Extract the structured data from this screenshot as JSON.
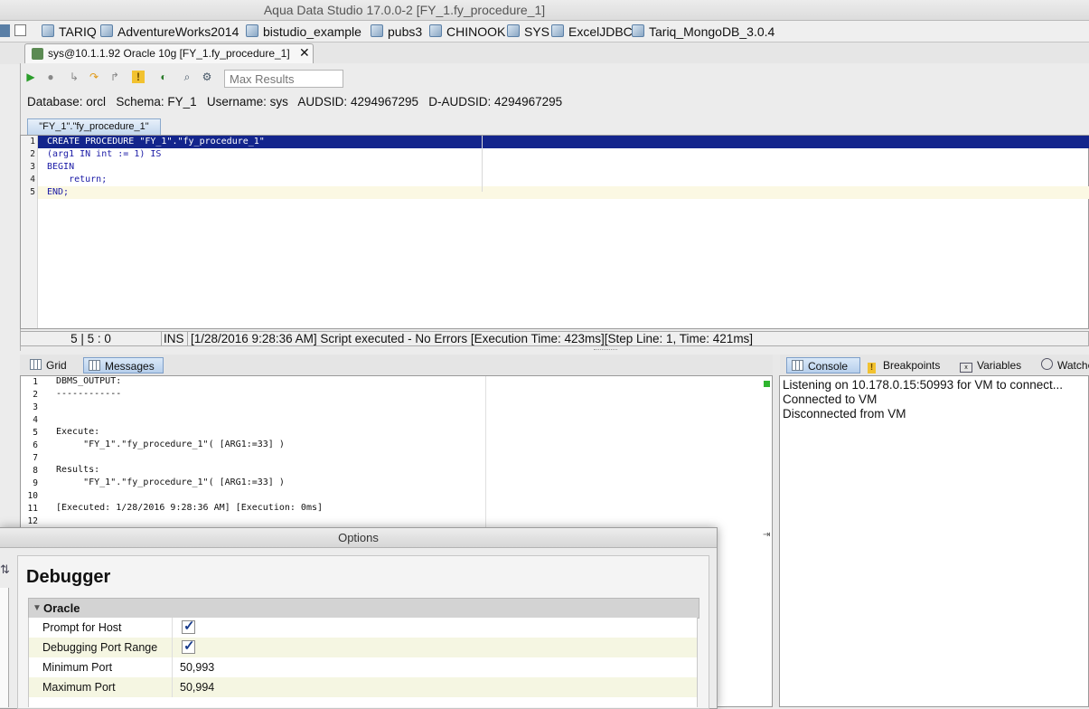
{
  "window": {
    "title": "Aqua Data Studio 17.0.0-2 [FY_1.fy_procedure_1]"
  },
  "bookmarks": [
    "TARIQ",
    "AdventureWorks2014",
    "bistudio_example",
    "pubs3",
    "CHINOOK",
    "SYS",
    "ExcelJDBC",
    "Tariq_MongoDB_3.0.4"
  ],
  "doc_tab": {
    "label": "sys@10.1.1.92 Oracle 10g [FY_1.fy_procedure_1]",
    "close": "✕"
  },
  "toolbar": {
    "max_results_placeholder": "Max Results"
  },
  "db_info": {
    "database": "orcl",
    "schema": "FY_1",
    "username": "sys",
    "audsid": "4294967295",
    "d_audsid": "4294967295"
  },
  "proc_tab": {
    "label": "\"FY_1\".\"fy_procedure_1\""
  },
  "editor": {
    "lines": [
      {
        "n": "1",
        "text": "CREATE PROCEDURE \"FY_1\".\"fy_procedure_1\""
      },
      {
        "n": "2",
        "text": "(arg1 IN int := 1) IS"
      },
      {
        "n": "3",
        "text": "BEGIN"
      },
      {
        "n": "4",
        "text": "    return;"
      },
      {
        "n": "5",
        "text": "END;"
      }
    ]
  },
  "status": {
    "position": "5 | 5 : 0",
    "mode": "INS",
    "message": "[1/28/2016 9:28:36 AM] Script executed - No Errors [Execution Time: 423ms][Step Line: 1, Time: 421ms]"
  },
  "results_tabs": [
    {
      "label": "Grid"
    },
    {
      "label": "Messages"
    }
  ],
  "messages": [
    {
      "n": "1",
      "text": "DBMS_OUTPUT:"
    },
    {
      "n": "2",
      "text": "------------"
    },
    {
      "n": "3",
      "text": ""
    },
    {
      "n": "4",
      "text": ""
    },
    {
      "n": "5",
      "text": "Execute:"
    },
    {
      "n": "6",
      "text": "     \"FY_1\".\"fy_procedure_1\"( [ARG1:=33] )"
    },
    {
      "n": "7",
      "text": ""
    },
    {
      "n": "8",
      "text": "Results:"
    },
    {
      "n": "9",
      "text": "     \"FY_1\".\"fy_procedure_1\"( [ARG1:=33] )"
    },
    {
      "n": "10",
      "text": ""
    },
    {
      "n": "11",
      "text": "[Executed: 1/28/2016 9:28:36 AM] [Execution: 0ms]"
    },
    {
      "n": "12",
      "text": ""
    }
  ],
  "debug_tabs": [
    {
      "label": "Console"
    },
    {
      "label": "Breakpoints"
    },
    {
      "label": "Variables"
    },
    {
      "label": "Watches"
    }
  ],
  "console": [
    "Listening on 10.178.0.15:50993 for VM to connect...",
    "Connected to VM",
    "Disconnected from VM"
  ],
  "options_dialog": {
    "title": "Options",
    "heading": "Debugger",
    "group": "Oracle",
    "rows": [
      {
        "key": "Prompt for Host",
        "checked": true
      },
      {
        "key": "Debugging Port Range",
        "checked": true
      },
      {
        "key": "Minimum Port",
        "value": "50,993"
      },
      {
        "key": "Maximum Port",
        "value": "50,994"
      }
    ]
  },
  "colors": {
    "selection": "#13258c",
    "accent_tab": "#b7cfec",
    "current_line": "#fbf8e3"
  }
}
